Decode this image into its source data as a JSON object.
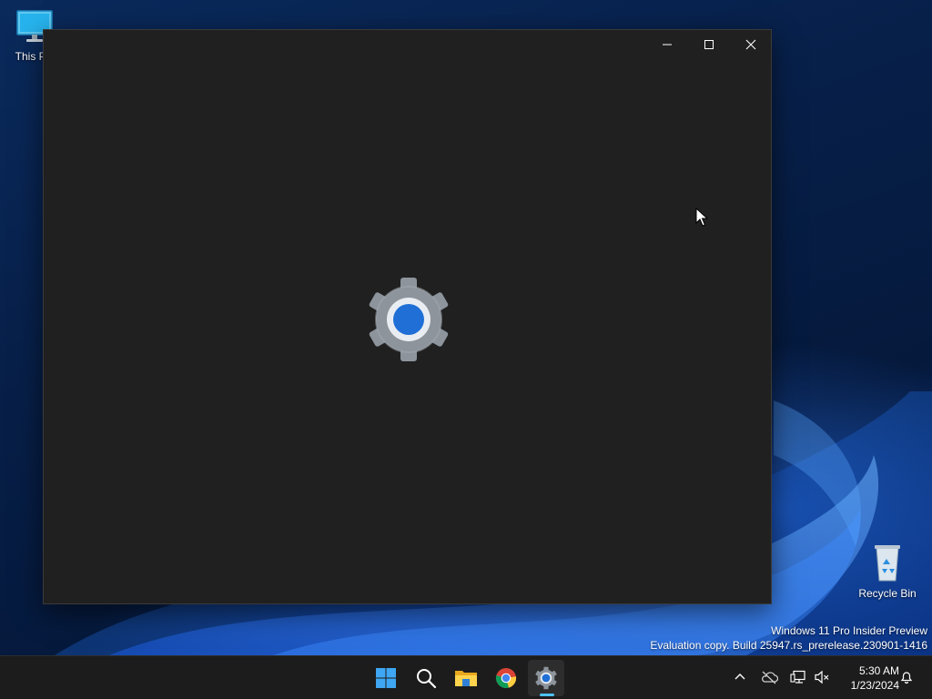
{
  "desktop": {
    "icons": [
      {
        "label": "This PC",
        "icon": "monitor-icon"
      },
      {
        "label": "Recycle Bin",
        "icon": "recycle-bin-icon"
      }
    ],
    "watermark": {
      "line1": "Windows 11 Pro Insider Preview",
      "line2": "Evaluation copy. Build 25947.rs_prerelease.230901-1416"
    }
  },
  "window": {
    "app": "Settings",
    "state": "loading-splash",
    "splash_icon": "settings-gear-icon",
    "caption_buttons": [
      "minimize-icon",
      "maximize-icon",
      "close-icon"
    ]
  },
  "taskbar": {
    "apps": [
      {
        "name": "Start",
        "icon": "windows-logo-icon"
      },
      {
        "name": "Search",
        "icon": "search-icon"
      },
      {
        "name": "File Explorer",
        "icon": "folder-icon"
      },
      {
        "name": "Google Chrome",
        "icon": "chrome-icon"
      },
      {
        "name": "Settings",
        "icon": "settings-gear-icon",
        "active": true
      }
    ],
    "tray": {
      "icons": [
        "chevron-up-icon",
        "onedrive-offline-icon",
        "network-icon",
        "volume-muted-icon",
        "notification-bell-icon"
      ],
      "time": "5:30 AM",
      "date": "1/23/2024"
    }
  },
  "colors": {
    "window_bg": "#202020",
    "taskbar_bg": "#1c1c1c",
    "accent": "#4cc2ff",
    "gear_center": "#1f6fd6"
  }
}
